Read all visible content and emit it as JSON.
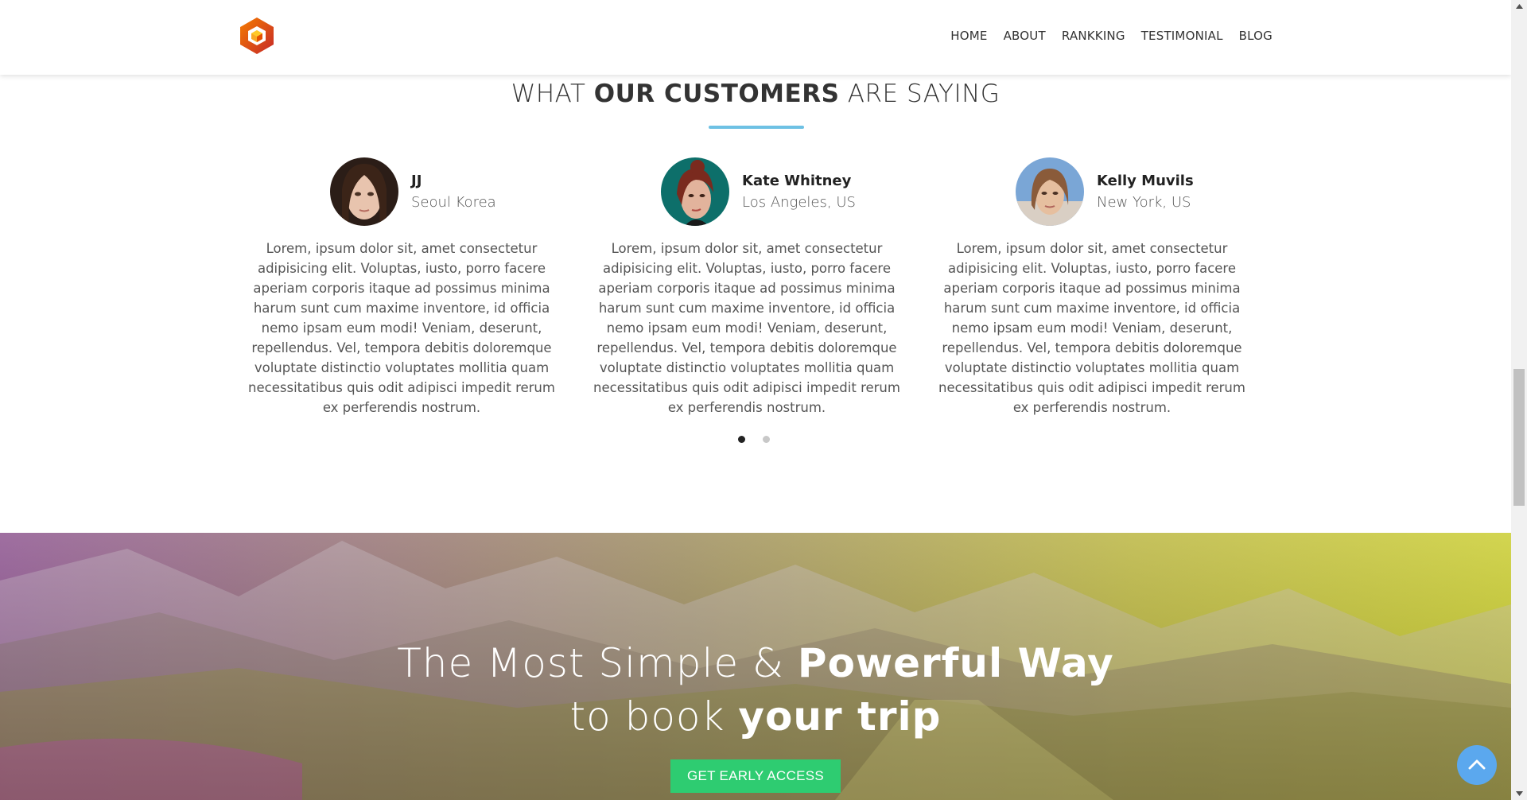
{
  "nav": {
    "links": [
      "HOME",
      "ABOUT",
      "RANKKING",
      "TESTIMONIAL",
      "BLOG"
    ]
  },
  "testimonials": {
    "title_pre": "WHAT ",
    "title_bold": "OUR CUSTOMERS",
    "title_post": " ARE SAYING",
    "items": [
      {
        "name": "JJ",
        "location": "Seoul Korea",
        "quote": "Lorem, ipsum dolor sit, amet consectetur adipisicing elit. Voluptas, iusto, porro facere aperiam corporis itaque ad possimus minima harum sunt cum maxime inventore, id officia nemo ipsam eum modi! Veniam, deserunt, repellendus. Vel, tempora debitis doloremque voluptate distinctio voluptates mollitia quam necessitatibus quis odit adipisci impedit rerum ex perferendis nostrum."
      },
      {
        "name": "Kate Whitney",
        "location": "Los Angeles, US",
        "quote": "Lorem, ipsum dolor sit, amet consectetur adipisicing elit. Voluptas, iusto, porro facere aperiam corporis itaque ad possimus minima harum sunt cum maxime inventore, id officia nemo ipsam eum modi! Veniam, deserunt, repellendus. Vel, tempora debitis doloremque voluptate distinctio voluptates mollitia quam necessitatibus quis odit adipisci impedit rerum ex perferendis nostrum."
      },
      {
        "name": "Kelly Muvils",
        "location": "New York, US",
        "quote": "Lorem, ipsum dolor sit, amet consectetur adipisicing elit. Voluptas, iusto, porro facere aperiam corporis itaque ad possimus minima harum sunt cum maxime inventore, id officia nemo ipsam eum modi! Veniam, deserunt, repellendus. Vel, tempora debitis doloremque voluptate distinctio voluptates mollitia quam necessitatibus quis odit adipisci impedit rerum ex perferendis nostrum."
      }
    ],
    "carousel_pages": 2,
    "active_page": 1
  },
  "hero": {
    "line1_light": "The Most Simple & ",
    "line1_bold": "Powerful Way",
    "line2_light": "to book ",
    "line2_bold": "your trip",
    "cta_label": "GET EARLY ACCESS"
  },
  "colors": {
    "accent_underline": "#6ec1e4",
    "cta_green": "#2ecc71",
    "to_top_blue": "#5ba8ee",
    "logo_red": "#e53935",
    "logo_orange": "#f9a825"
  },
  "icons": {
    "logo": "hexagon-cube-logo-icon",
    "to_top": "chevron-up-icon"
  }
}
